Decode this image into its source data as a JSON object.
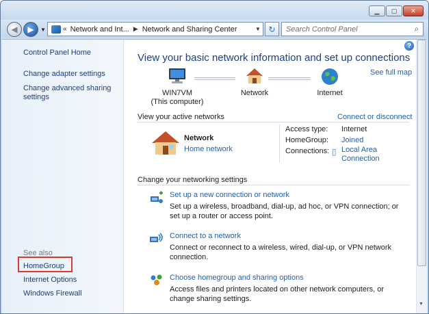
{
  "address": {
    "crumb1": "Network and Int...",
    "crumb2": "Network and Sharing Center",
    "search_placeholder": "Search Control Panel"
  },
  "leftpane": {
    "home": "Control Panel Home",
    "links": [
      "Change adapter settings",
      "Change advanced sharing",
      "settings"
    ],
    "see_also": "See also",
    "see_also_items": [
      "HomeGroup",
      "Internet Options",
      "Windows Firewall"
    ]
  },
  "main": {
    "title": "View your basic network information and set up connections",
    "see_full_map": "See full map",
    "map": {
      "computer_line1": "WIN7VM",
      "computer_line2": "(This computer)",
      "network": "Network",
      "internet": "Internet"
    },
    "active": {
      "heading": "View your active networks",
      "connect_link": "Connect or disconnect",
      "network_name": "Network",
      "network_type": "Home network",
      "access_label": "Access type:",
      "access_value": "Internet",
      "homegroup_label": "HomeGroup:",
      "homegroup_value": "Joined",
      "connections_label": "Connections:",
      "connections_value_1": "Local Area",
      "connections_value_2": "Connection"
    },
    "settings": {
      "heading": "Change your networking settings",
      "tasks": [
        {
          "title": "Set up a new connection or network",
          "desc": "Set up a wireless, broadband, dial-up, ad hoc, or VPN connection; or set up a router or access point."
        },
        {
          "title": "Connect to a network",
          "desc": "Connect or reconnect to a wireless, wired, dial-up, or VPN network connection."
        },
        {
          "title": "Choose homegroup and sharing options",
          "desc": "Access files and printers located on other network computers, or change sharing settings."
        }
      ]
    }
  },
  "colors": {
    "link": "#1f5fb3",
    "title": "#1e3f80",
    "highlight": "#e0362c"
  },
  "icons": [
    "minimize-icon",
    "maximize-icon",
    "close-icon",
    "back-arrow-icon",
    "forward-arrow-icon",
    "refresh-icon",
    "search-icon",
    "help-icon",
    "computer-icon",
    "house-icon",
    "globe-icon"
  ]
}
